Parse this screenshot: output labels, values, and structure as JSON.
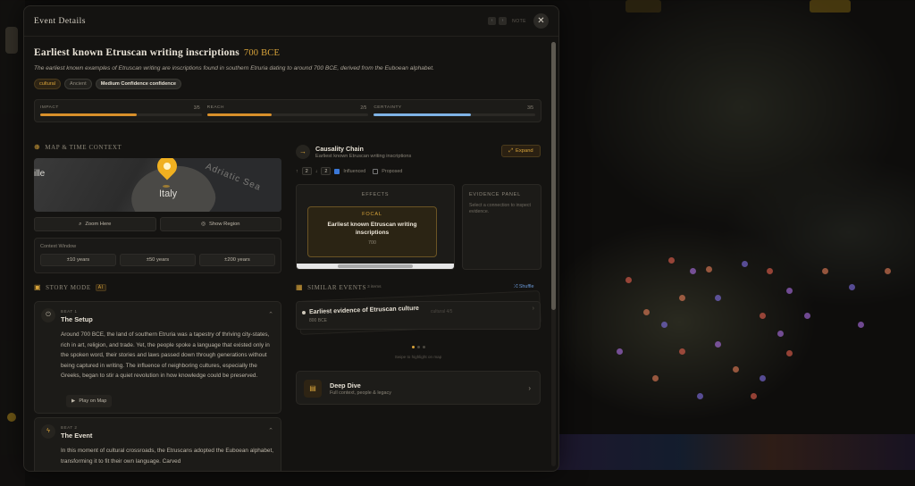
{
  "modal": {
    "title": "Event Details",
    "header_note": "NOTE",
    "prev_glyph": "‹",
    "next_glyph": "›",
    "close_glyph": "✕"
  },
  "event": {
    "title": "Earliest known Etruscan writing inscriptions",
    "year": "700 BCE",
    "description": "The earliest known examples of Etruscan writing are inscriptions found in southern Etruria dating to around 700 BCE, derived from the Euboean alphabet.",
    "tags": [
      "cultural",
      "Ancient",
      "Medium Confidence confidence"
    ]
  },
  "metrics": [
    {
      "label": "IMPACT",
      "value": "3/5",
      "fraction": 0.6,
      "color": "#d9902a"
    },
    {
      "label": "REACH",
      "value": "2/5",
      "fraction": 0.4,
      "color": "#d9902a"
    },
    {
      "label": "CERTAINTY",
      "value": "3/5",
      "fraction": 0.6,
      "color": "#7fb3e6"
    }
  ],
  "map_section": {
    "label": "MAP & TIME CONTEXT",
    "label_left": "ille",
    "label_country": "Italy",
    "label_sea": "Adriatic Sea",
    "zoom_button": "Zoom Here",
    "show_region_button": "Show Region",
    "context_window_label": "Context Window",
    "context_options": [
      "±10 years",
      "±50 years",
      "±200 years"
    ]
  },
  "story": {
    "label": "STORY MODE",
    "badge": "AI",
    "beats": [
      {
        "num": "BEAT 1",
        "title": "The Setup",
        "text": "Around 700 BCE, the land of southern Etruria was a tapestry of thriving city-states, rich in art, religion, and trade. Yet, the people spoke a language that existed only in the spoken word, their stories and laws passed down through generations without being captured in writing. The influence of neighboring cultures, especially the Greeks, began to stir a quiet revolution in how knowledge could be preserved.",
        "play_label": "Play on Map"
      },
      {
        "num": "BEAT 2",
        "title": "The Event",
        "text": "In this moment of cultural crossroads, the Etruscans adopted the Euboean alphabet, transforming it to fit their own language. Carved"
      }
    ]
  },
  "causality": {
    "title": "Causality Chain",
    "subtitle": "Earliest known Etruscan writing inscriptions",
    "expand_label": "Expand",
    "up_select": "2",
    "down_select": "2",
    "influenced_label": "Influenced",
    "proposed_label": "Proposed",
    "effects_label": "EFFECTS",
    "focal_label": "FOCAL",
    "focal_title": "Earliest known Etruscan writing inscriptions",
    "focal_year": "700",
    "evidence_label": "EVIDENCE PANEL",
    "evidence_hint": "Select a connection to inspect evidence."
  },
  "similar": {
    "label": "SIMILAR EVENTS",
    "count": "3 items",
    "shuffle_label": "Shuffle",
    "card_title": "Earliest evidence of Etruscan culture",
    "card_year": "800 BCE",
    "card_score": "cultural 4/5",
    "pager_hint": "Swipe to highlight on map"
  },
  "deep_dive": {
    "title": "Deep Dive",
    "subtitle": "Full context, people & legacy"
  }
}
